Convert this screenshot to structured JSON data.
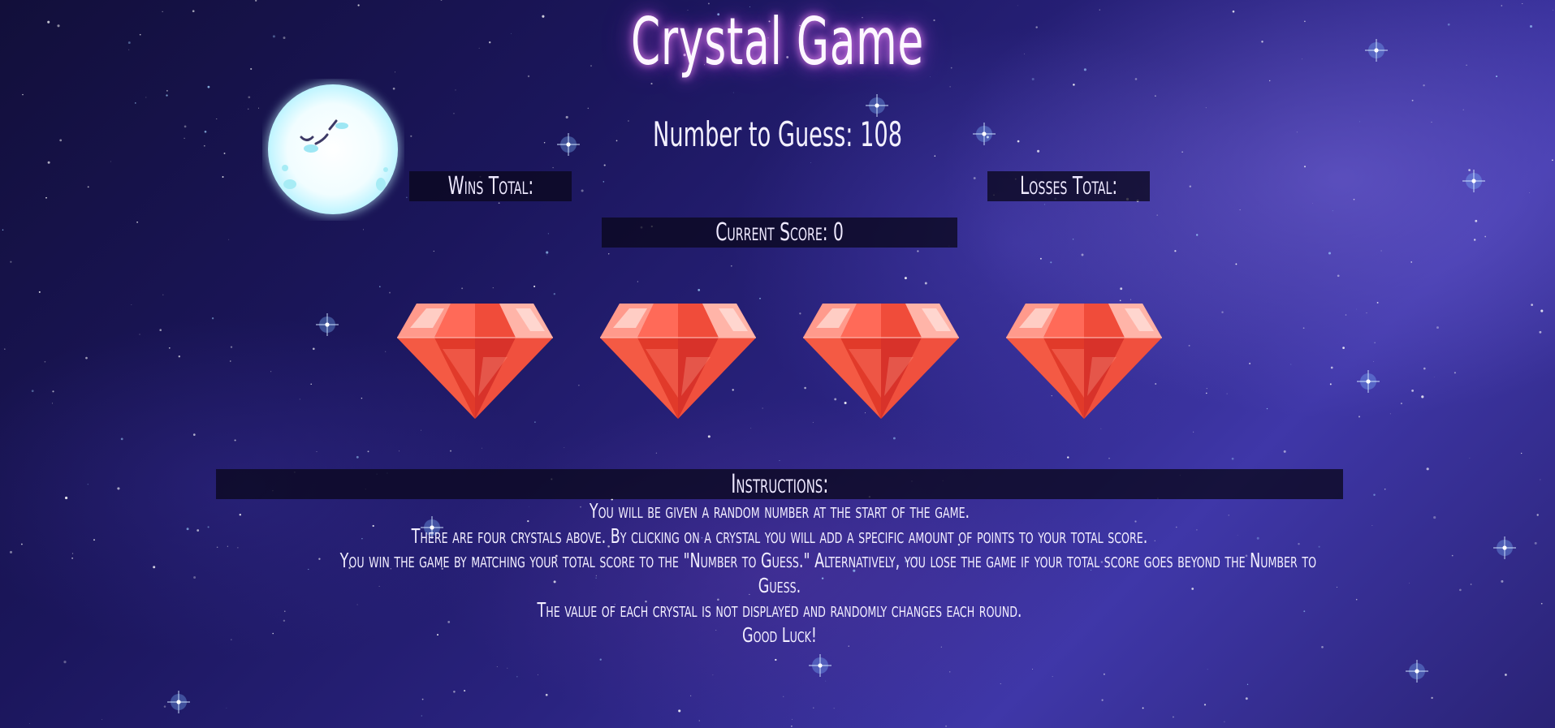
{
  "game": {
    "title": "Crystal Game",
    "number_to_guess_label": "Number to Guess: 108",
    "wins_label": "Wins Total:",
    "losses_label": "Losses Total:",
    "current_score_label": "Current Score: 0"
  },
  "crystals": [
    {
      "color": "#e8382a"
    },
    {
      "color": "#e8382a"
    },
    {
      "color": "#e8382a"
    },
    {
      "color": "#e8382a"
    }
  ],
  "instructions": {
    "heading": "Instructions:",
    "lines": [
      "You will be given a random number at the start of the game.",
      "There are four crystals above. By clicking on a crystal you will add a specific amount of points to your total score.",
      "You win the game by matching your total score to the \"Number to Guess.\" Alternatively, you lose the game if your total score goes beyond the Number to",
      "Guess.",
      "The value of each crystal is not displayed and randomly changes each round.",
      "Good Luck!"
    ]
  },
  "colors": {
    "title_glow": "#e87cff",
    "panel_bg": "#0a081e",
    "crystal_red": "#e8382a",
    "moon_glow": "#d6fbff"
  },
  "icons": [
    "moon-icon",
    "crystal-icon"
  ]
}
